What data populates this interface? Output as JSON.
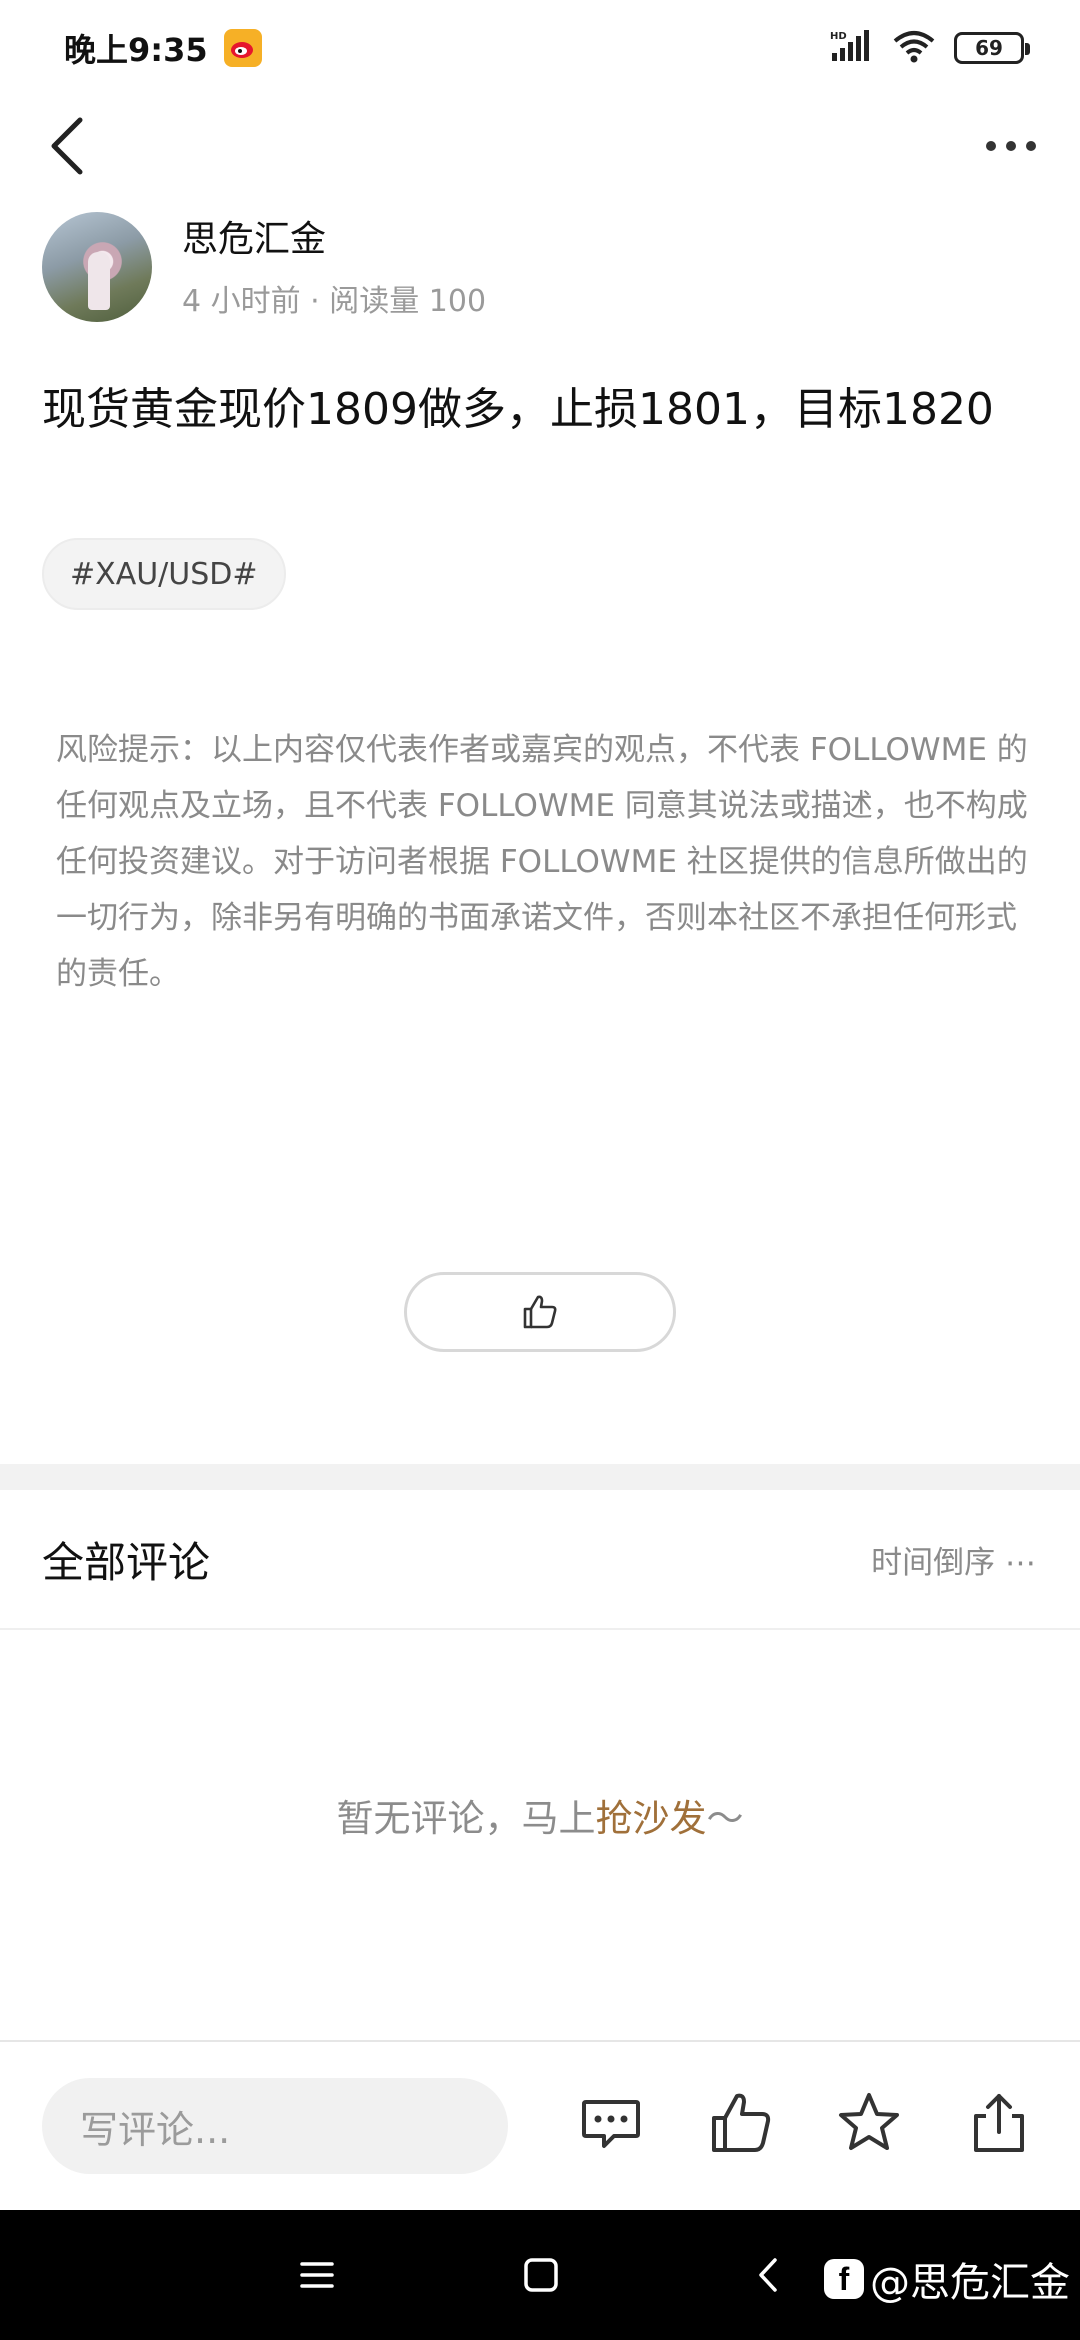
{
  "status_bar": {
    "time": "晚上9:35",
    "battery": "69",
    "network": "HD"
  },
  "nav": {
    "back_icon": "chevron-left-icon",
    "more_icon": "more-horizontal-icon"
  },
  "author": {
    "name": "思危汇金",
    "meta": "4 小时前 · 阅读量 100"
  },
  "post": {
    "title": "现货黄金现价1809做多，止损1801，目标1820",
    "tag": "#XAU/USD#",
    "disclaimer": "风险提示：以上内容仅代表作者或嘉宾的观点，不代表 FOLLOWME 的任何观点及立场，且不代表 FOLLOWME 同意其说法或描述，也不构成任何投资建议。对于访问者根据 FOLLOWME 社区提供的信息所做出的一切行为，除非另有明确的书面承诺文件，否则本社区不承担任何形式的责任。"
  },
  "comments": {
    "title": "全部评论",
    "sort": "时间倒序 ⋯",
    "empty_prefix": "暂无评论，马上",
    "empty_link": "抢沙发",
    "empty_suffix": "～"
  },
  "bottom_bar": {
    "input_placeholder": "写评论...",
    "icons": [
      "comment-icon",
      "thumbs-up-icon",
      "star-icon",
      "share-icon"
    ]
  },
  "system_nav": {
    "watermark": "@思危汇金"
  },
  "colors": {
    "accent": "#a0703a",
    "muted": "#8a8a8a",
    "band": "#f2f2f2"
  }
}
